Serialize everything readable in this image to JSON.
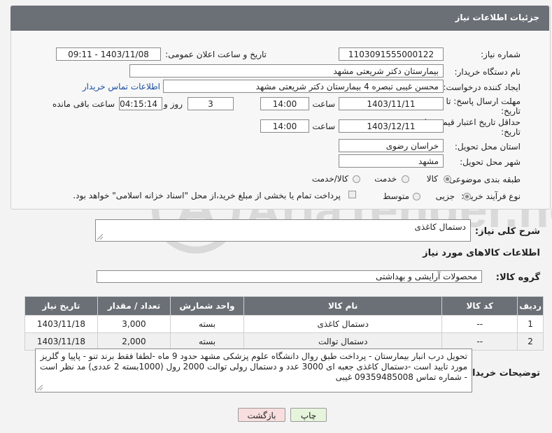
{
  "header": {
    "title": "جزئیات اطلاعات نیاز"
  },
  "fields": {
    "need_number_label": "شماره نیاز:",
    "need_number": "1103091555000122",
    "announce_label": "تاریخ و ساعت اعلان عمومی:",
    "announce_value": "1403/11/08 - 09:11",
    "buyer_org_label": "نام دستگاه خریدار:",
    "buyer_org": "بیمارستان دکتر شریعتی مشهد",
    "requester_label": "ایجاد کننده درخواست:",
    "requester": "محسن غیبی تبصره 4 بیمارستان دکتر شریعتی مشهد",
    "contact_link": "اطلاعات تماس خریدار",
    "reply_deadline_label_1": "مهلت ارسال پاسخ: تا",
    "reply_deadline_label_2": "تاریخ:",
    "reply_date": "1403/11/11",
    "time_label": "ساعت",
    "reply_time": "14:00",
    "days_value": "3",
    "days_label": "روز و",
    "remaining_time": "04:15:14",
    "remaining_label": "ساعت باقی مانده",
    "validity_label_1": "حداقل تاریخ اعتبار قیمت: تا",
    "validity_label_2": "تاریخ:",
    "validity_date": "1403/12/11",
    "validity_time": "14:00",
    "province_label": "استان محل تحویل:",
    "province": "خراسان رضوی",
    "city_label": "شهر محل تحویل:",
    "city": "مشهد",
    "category_label": "طبقه بندی موضوعی:",
    "category_goods": "کالا",
    "category_service": "خدمت",
    "category_goods_service": "کالا/خدمت",
    "process_label": "نوع فرآیند خرید :",
    "process_minor": "جزیی",
    "process_medium": "متوسط",
    "payment_note": "پرداخت تمام یا بخشی از مبلغ خرید،از محل \"اسناد خزانه اسلامی\" خواهد بود."
  },
  "summary": {
    "label": "شرح کلی نیاز:",
    "value": "دستمال کاغذی"
  },
  "goods_section": {
    "title": "اطلاعات کالاهای مورد نیاز",
    "group_label": "گروه کالا:",
    "group_value": "محصولات آرایشی و بهداشتی"
  },
  "table": {
    "headers": [
      "ردیف",
      "کد کالا",
      "نام کالا",
      "واحد شمارش",
      "تعداد / مقدار",
      "تاریخ نیاز"
    ],
    "rows": [
      [
        "1",
        "--",
        "دستمال کاغذی",
        "بسته",
        "3,000",
        "1403/11/18"
      ],
      [
        "2",
        "--",
        "دستمال توالت",
        "بسته",
        "2,000",
        "1403/11/18"
      ]
    ]
  },
  "notes": {
    "label": "توضیحات خریدار:",
    "value": "تحویل درب انبار بیمارستان - پرداخت طبق روال دانشگاه علوم پزشکی مشهد حدود 9 ماه -لطفا فقط برند تنو - پاپیا و گلریز مورد تایید است -دستمال کاغذی جعبه ای 3000 عدد و دستمال رولی توالت 2000 رول (1000بسته 2 عددی) مد نظر است - شماره تماس 09359485008 غیبی"
  },
  "buttons": {
    "print": "چاپ",
    "back": "بازگشت"
  },
  "watermark": {
    "text": "AriaTender.neT"
  },
  "colors": {
    "header_bg": "#6b6f76",
    "link": "#1a4fa3",
    "print_btn": "#e6f4dc",
    "back_btn": "#f8dede"
  }
}
